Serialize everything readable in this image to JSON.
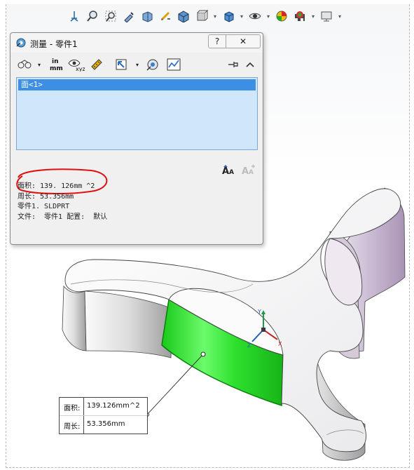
{
  "dialog": {
    "title": "测量 - 零件1",
    "help_label": "?",
    "close_label": "✕",
    "selection_list": [
      "面<1>"
    ],
    "results": {
      "area": "面积: 139. 126mm ^2",
      "perimeter": "周长: 53.356mm",
      "part": "零件1. SLDPRT",
      "file": "文件:  零件1 配置:  默认"
    },
    "units_icon_label": "in\nmm"
  },
  "callout": {
    "area_label": "面积:",
    "area_value": "139.126mm^2",
    "perimeter_label": "周长:",
    "perimeter_value": "53.356mm"
  },
  "triad": {
    "x_label": "X",
    "y_label": "Y",
    "z_label": "Z"
  },
  "colors": {
    "highlight_face": "#22d622",
    "list_bg": "#cfe6fb",
    "list_selected": "#3d8ee5",
    "annotation_red": "#e01010",
    "body_white": "#f6f6f6",
    "body_purple": "#b6a7c2"
  }
}
